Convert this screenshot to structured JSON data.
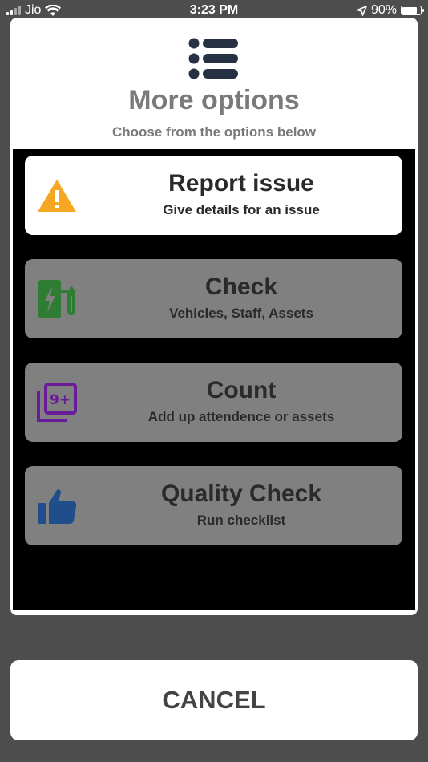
{
  "status_bar": {
    "carrier": "Jio",
    "time": "3:23 PM",
    "battery": "90%",
    "battery_level": 0.9
  },
  "sheet": {
    "header_icon": "list-icon",
    "title": "More options",
    "subtitle": "Choose from the options below"
  },
  "options": [
    {
      "title": "Report issue",
      "subtitle": "Give details for an issue",
      "icon": "warning-icon",
      "icon_color": "#f5a623",
      "selected": true
    },
    {
      "title": "Check",
      "subtitle": "Vehicles, Staff, Assets",
      "icon": "ev-charger-icon",
      "icon_color": "#2e7d32",
      "selected": false
    },
    {
      "title": "Count",
      "subtitle": "Add up attendence or assets",
      "icon": "filter-9-plus-icon",
      "icon_color": "#6a1b9a",
      "selected": false
    },
    {
      "title": "Quality Check",
      "subtitle": "Run checklist",
      "icon": "thumbs-up-icon",
      "icon_color": "#1f4e8a",
      "selected": false
    }
  ],
  "cancel_label": "CANCEL"
}
